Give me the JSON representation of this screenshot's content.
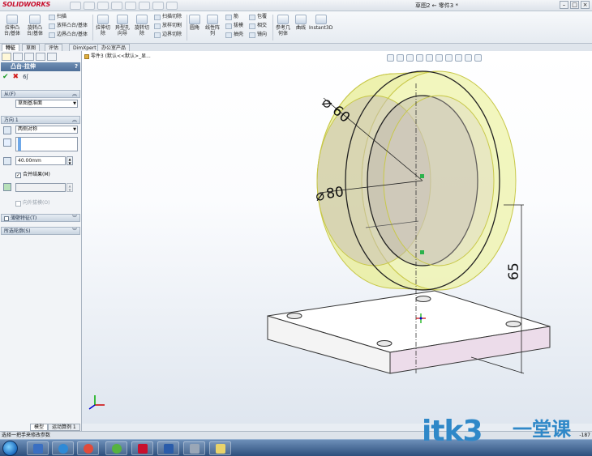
{
  "app": {
    "logo_text": "SOLIDWORKS",
    "doc_title": "草图2 ← 零件3 *"
  },
  "ribbon": {
    "big_buttons": [
      {
        "label1": "拉伸凸",
        "label2": "台/基体"
      },
      {
        "label1": "旋转凸",
        "label2": "台/基体"
      },
      {
        "label1": "拉伸切",
        "label2": "除"
      },
      {
        "label1": "异型孔",
        "label2": "向导"
      },
      {
        "label1": "旋转切",
        "label2": "除"
      },
      {
        "label1": "圆角",
        "label2": ""
      },
      {
        "label1": "线性阵",
        "label2": "列"
      },
      {
        "label1": "参考几",
        "label2": "何体"
      },
      {
        "label1": "曲线",
        "label2": ""
      },
      {
        "label1": "Instant3D",
        "label2": ""
      }
    ],
    "small_col1": [
      "扫描",
      "放样凸台/基体",
      "边界凸台/基体"
    ],
    "small_col2": [
      "扫描切除",
      "放样切割",
      "边界切除"
    ],
    "small_col3": [
      "筋",
      "拔模",
      "抽壳"
    ],
    "small_col4": [
      "包覆",
      "相交",
      "镜向"
    ]
  },
  "command_tabs": [
    "特征",
    "草图",
    "评估",
    "DimXpert",
    "办公室产品"
  ],
  "property_manager": {
    "title": "凸台-拉伸",
    "help": "?",
    "from_section": "从(F)",
    "from_value": "草图基准面",
    "direction_section": "方向 1",
    "direction_type": "两侧对称",
    "depth_value": "40.00mm",
    "merge_result": "合并结果(M)",
    "draft_outward": "向外拔模(O)",
    "thin_feature": "薄壁特征(T)",
    "selected_contours": "所选轮廓(S)"
  },
  "viewport": {
    "tree_label": "零件3 (默认<<默认>_显...",
    "dim_60": "60",
    "dim_80": "80",
    "dim_65": "65"
  },
  "model_tabs": [
    "模型",
    "运动算例 1"
  ],
  "status": {
    "message": "选择一把手来修改参数",
    "right": "-187"
  },
  "watermark": {
    "latin": "itk3",
    "cn": "一堂课"
  },
  "colors": {
    "accent_blue": "#4e6f99",
    "cylinder_fill": "#eef3a8",
    "cylinder_edge": "#c8c84a",
    "plate_side": "#e8d8e6",
    "watermark": "#2f88c8"
  }
}
